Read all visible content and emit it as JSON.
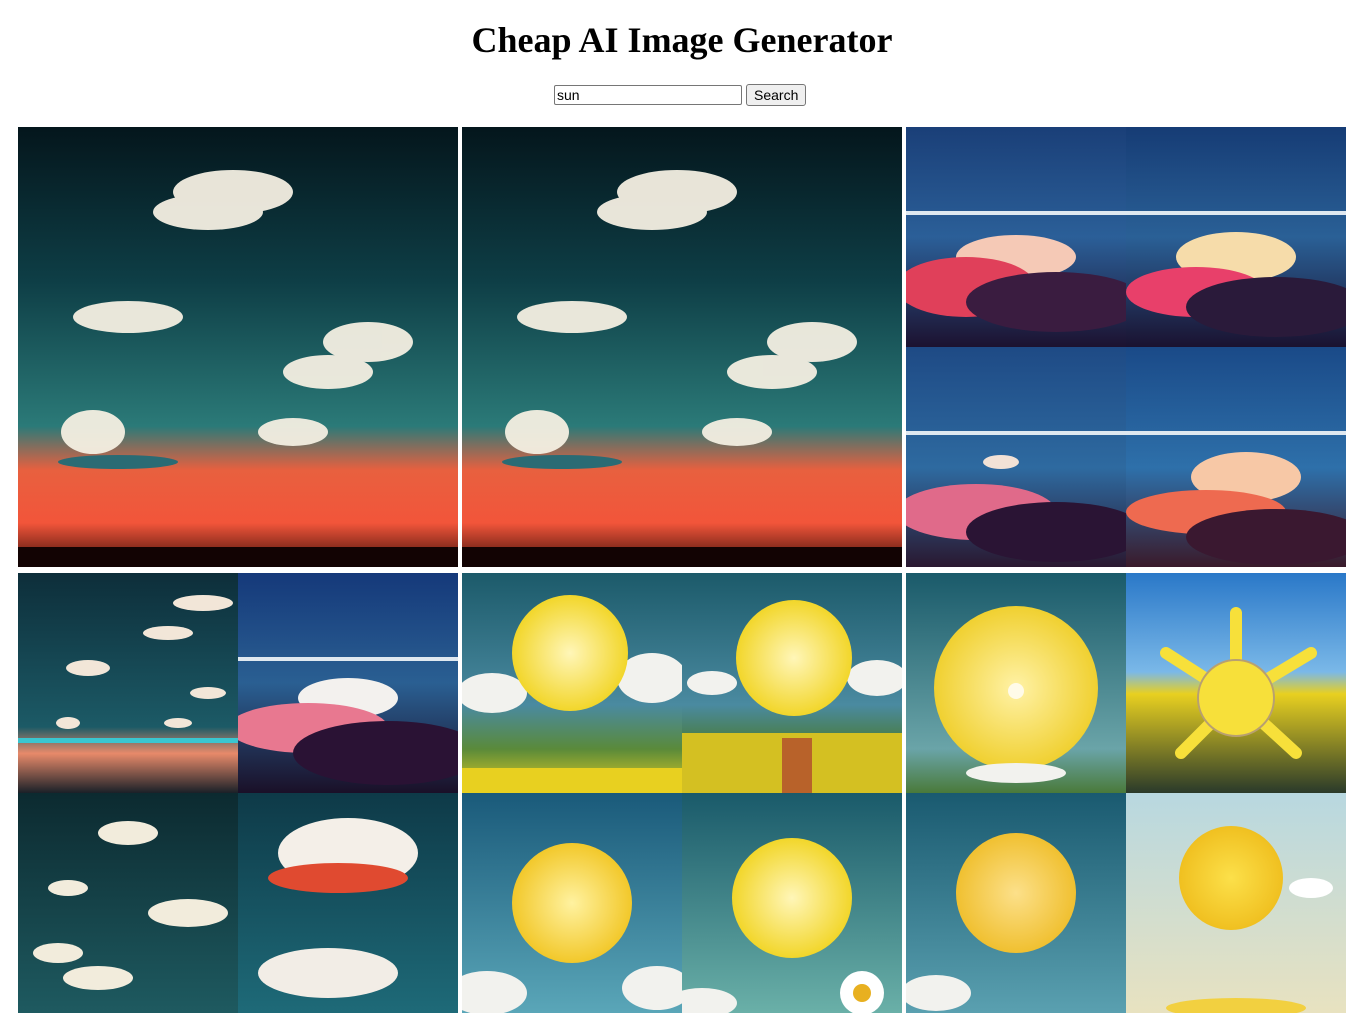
{
  "page": {
    "title": "Cheap AI Image Generator"
  },
  "search": {
    "value": "sun",
    "button_label": "Search"
  },
  "colors": {
    "sky_teal": "#1f5e60",
    "sky_blue": "#1e4b8a",
    "sunset_orange": "#f0603a",
    "sun_yellow": "#f7e03a",
    "field_yellow": "#e8d020"
  },
  "gallery": {
    "results": [
      {
        "name": "cloud-sky-sunset-large"
      },
      {
        "name": "cloud-sky-sunset-large-duplicate"
      },
      {
        "name": "clouds-quad-grid"
      },
      {
        "name": "wispy-clouds-quad-grid"
      },
      {
        "name": "sun-over-field-quad-grid"
      },
      {
        "name": "sun-with-rays-quad-grid"
      }
    ]
  }
}
